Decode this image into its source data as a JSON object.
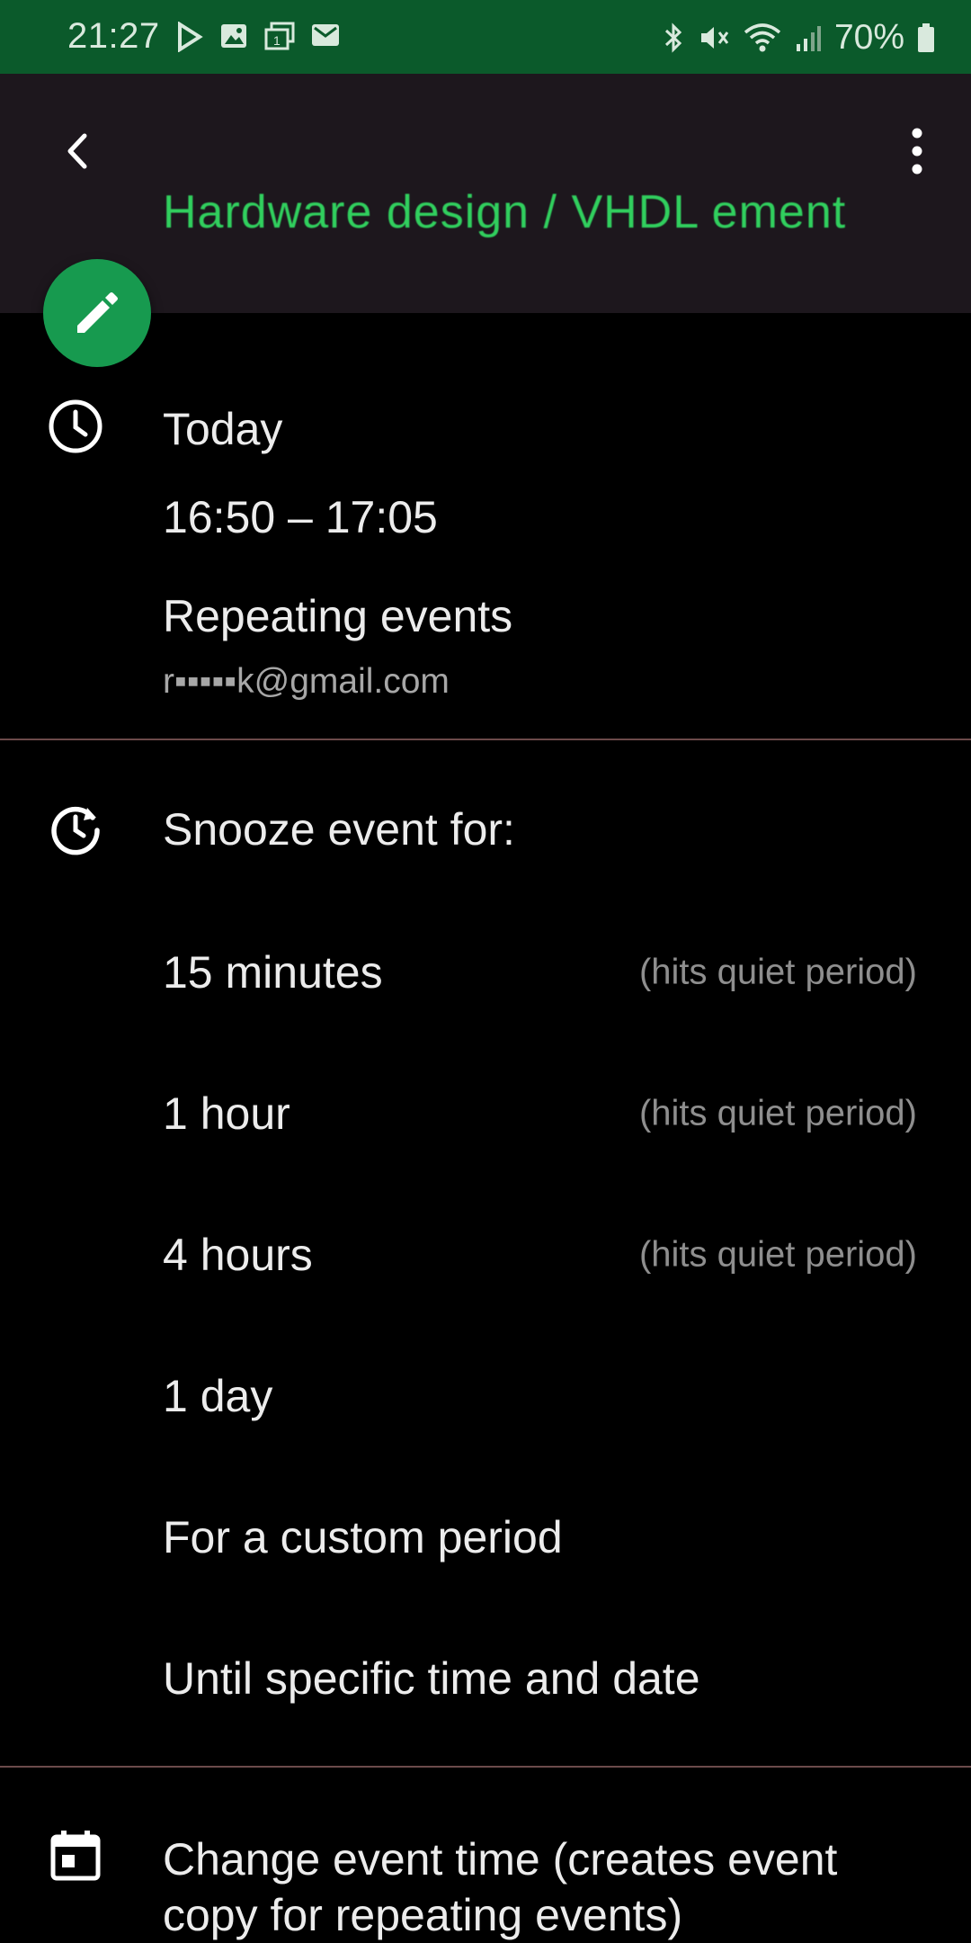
{
  "status_bar": {
    "time": "21:27",
    "battery": "70%",
    "left_icons": [
      "play-icon",
      "image-icon",
      "calendar-notification-icon",
      "mail-icon"
    ],
    "right_icons": [
      "bluetooth-icon",
      "mute-icon",
      "wifi-icon",
      "signal-icon",
      "battery-icon"
    ],
    "background": "#0b5a2b"
  },
  "toolbar": {
    "title": "Hardware design / VHDL ement",
    "title_color": "#31cf5e",
    "background": "#1d171d"
  },
  "event": {
    "date": "Today",
    "time_range": "16:50 – 17:05",
    "calendar": "Repeating events",
    "account": "r▪▪▪▪▪k@gmail.com"
  },
  "snooze": {
    "title": "Snooze event for:",
    "options": [
      {
        "label": "15 minutes",
        "note": "(hits quiet period)"
      },
      {
        "label": "1 hour",
        "note": "(hits quiet period)"
      },
      {
        "label": "4 hours",
        "note": "(hits quiet period)"
      },
      {
        "label": "1 day",
        "note": ""
      },
      {
        "label": "For a custom period",
        "note": ""
      },
      {
        "label": "Until specific time and date",
        "note": ""
      }
    ]
  },
  "change_time": {
    "label": "Change event time (creates event copy for repeating events)"
  },
  "colors": {
    "fab": "#179a4f",
    "divider": "#6b4a4a",
    "note_text": "#8e8e8e"
  }
}
